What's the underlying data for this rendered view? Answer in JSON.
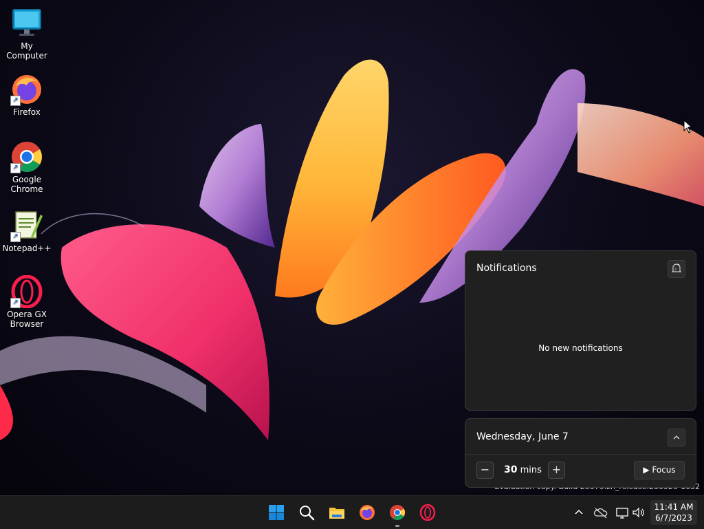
{
  "desktop": {
    "icons": [
      {
        "label": "My Computer",
        "icon": "monitor-icon"
      },
      {
        "label": "Firefox",
        "icon": "firefox-icon"
      },
      {
        "label": "Google Chrome",
        "icon": "chrome-icon"
      },
      {
        "label": "Notepad++",
        "icon": "notepadpp-icon"
      },
      {
        "label": "Opera GX Browser",
        "icon": "opera-gx-icon"
      }
    ],
    "watermark": "Evaluation copy. Build 25375.zn_release.230520-1632"
  },
  "notifications": {
    "title": "Notifications",
    "empty_text": "No new notifications",
    "settings_icon": "notification-settings-icon"
  },
  "calendar": {
    "date": "Wednesday, June 7",
    "focus": {
      "duration_value": "30",
      "duration_unit": "mins",
      "button_label": "Focus"
    }
  },
  "taskbar": {
    "apps": [
      {
        "name": "Start",
        "icon": "windows-start-icon"
      },
      {
        "name": "Search",
        "icon": "search-icon"
      },
      {
        "name": "File Explorer",
        "icon": "folder-icon"
      },
      {
        "name": "Firefox",
        "icon": "firefox-icon"
      },
      {
        "name": "Google Chrome",
        "icon": "chrome-icon",
        "running": true
      },
      {
        "name": "Opera GX",
        "icon": "opera-gx-icon"
      }
    ],
    "tray_icons": [
      "chevron-up-icon",
      "onedrive-icon",
      "network-icon",
      "volume-icon"
    ],
    "clock": {
      "time": "11:41 AM",
      "date": "6/7/2023"
    }
  },
  "colors": {
    "panel_bg": "#202020",
    "taskbar_bg": "#1c1c1c",
    "accent": "#0078d4"
  }
}
